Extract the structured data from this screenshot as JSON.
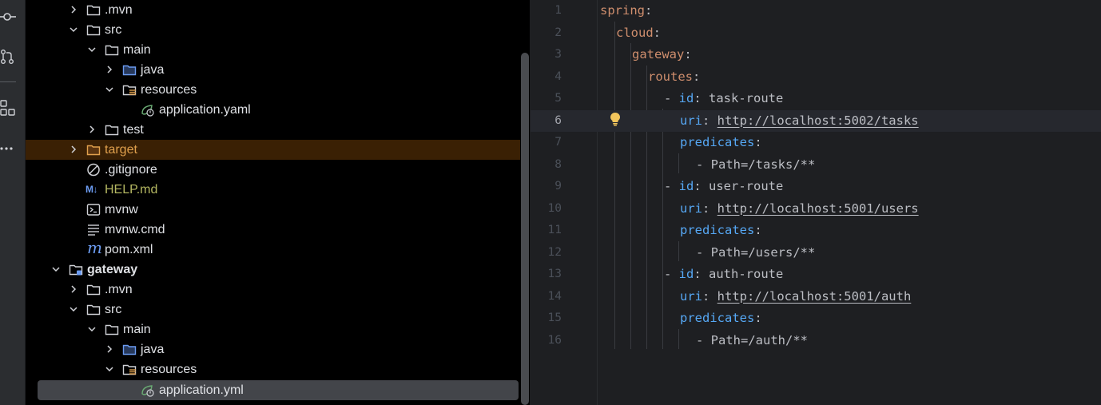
{
  "project_tree": {
    "rows": [
      {
        "label": ".mvn",
        "chevron": "right",
        "icon": "folder-icon"
      },
      {
        "label": "src",
        "chevron": "down",
        "icon": "folder-icon"
      },
      {
        "label": "main",
        "chevron": "down",
        "icon": "folder-icon"
      },
      {
        "label": "java",
        "chevron": "right",
        "icon": "source-folder-icon"
      },
      {
        "label": "resources",
        "chevron": "down",
        "icon": "resources-folder-icon"
      },
      {
        "label": "application.yaml",
        "icon": "spring-config-icon"
      },
      {
        "label": "test",
        "chevron": "right",
        "icon": "folder-icon"
      },
      {
        "label": "target",
        "chevron": "right",
        "icon": "excluded-folder-icon",
        "state": "excluded"
      },
      {
        "label": ".gitignore",
        "icon": "ignore-icon"
      },
      {
        "label": "HELP.md",
        "icon": "markdown-icon",
        "badge": "M↓"
      },
      {
        "label": "mvnw",
        "icon": "terminal-icon"
      },
      {
        "label": "mvnw.cmd",
        "icon": "text-file-icon"
      },
      {
        "label": "pom.xml",
        "icon": "maven-icon",
        "badge": "m"
      },
      {
        "label": "gateway",
        "chevron": "down",
        "icon": "module-folder-icon",
        "bold": true
      },
      {
        "label": ".mvn",
        "chevron": "right",
        "icon": "folder-icon"
      },
      {
        "label": "src",
        "chevron": "down",
        "icon": "folder-icon"
      },
      {
        "label": "main",
        "chevron": "down",
        "icon": "folder-icon"
      },
      {
        "label": "java",
        "chevron": "right",
        "icon": "source-folder-icon"
      },
      {
        "label": "resources",
        "chevron": "down",
        "icon": "resources-folder-icon"
      },
      {
        "label": "application.yml",
        "icon": "spring-config-icon",
        "selected": true
      }
    ]
  },
  "editor": {
    "current_line": 6,
    "lines": [
      {
        "n": "1",
        "key": "spring",
        "colon": ":"
      },
      {
        "n": "2",
        "key": "cloud",
        "colon": ":"
      },
      {
        "n": "3",
        "key": "gateway",
        "colon": ":"
      },
      {
        "n": "4",
        "key": "routes",
        "colon": ":"
      },
      {
        "n": "5",
        "dash": "- ",
        "key": "id",
        "colon": ": ",
        "value": "task-route"
      },
      {
        "n": "6",
        "key": "uri",
        "colon": ": ",
        "url": "http://localhost:5002/tasks"
      },
      {
        "n": "7",
        "key": "predicates",
        "colon": ":"
      },
      {
        "n": "8",
        "dash": "- ",
        "value": "Path=/tasks/**"
      },
      {
        "n": "9",
        "dash": "- ",
        "key": "id",
        "colon": ": ",
        "value": "user-route"
      },
      {
        "n": "10",
        "key": "uri",
        "colon": ": ",
        "url": "http://localhost:5001/users"
      },
      {
        "n": "11",
        "key": "predicates",
        "colon": ":"
      },
      {
        "n": "12",
        "dash": "- ",
        "value": "Path=/users/**"
      },
      {
        "n": "13",
        "dash": "- ",
        "key": "id",
        "colon": ": ",
        "value": "auth-route"
      },
      {
        "n": "14",
        "key": "uri",
        "colon": ": ",
        "url": "http://localhost:5001/auth"
      },
      {
        "n": "15",
        "key": "predicates",
        "colon": ":"
      },
      {
        "n": "16",
        "dash": "- ",
        "value": "Path=/auth/**"
      }
    ]
  },
  "colors": {
    "tree_bg": "#000000",
    "editor_bg": "#1e1f22",
    "yaml_root_key": "#cf8e6d",
    "yaml_nested_key": "#56a8f5",
    "excluded_highlight": "#3a2004",
    "selection": "#43454a"
  }
}
